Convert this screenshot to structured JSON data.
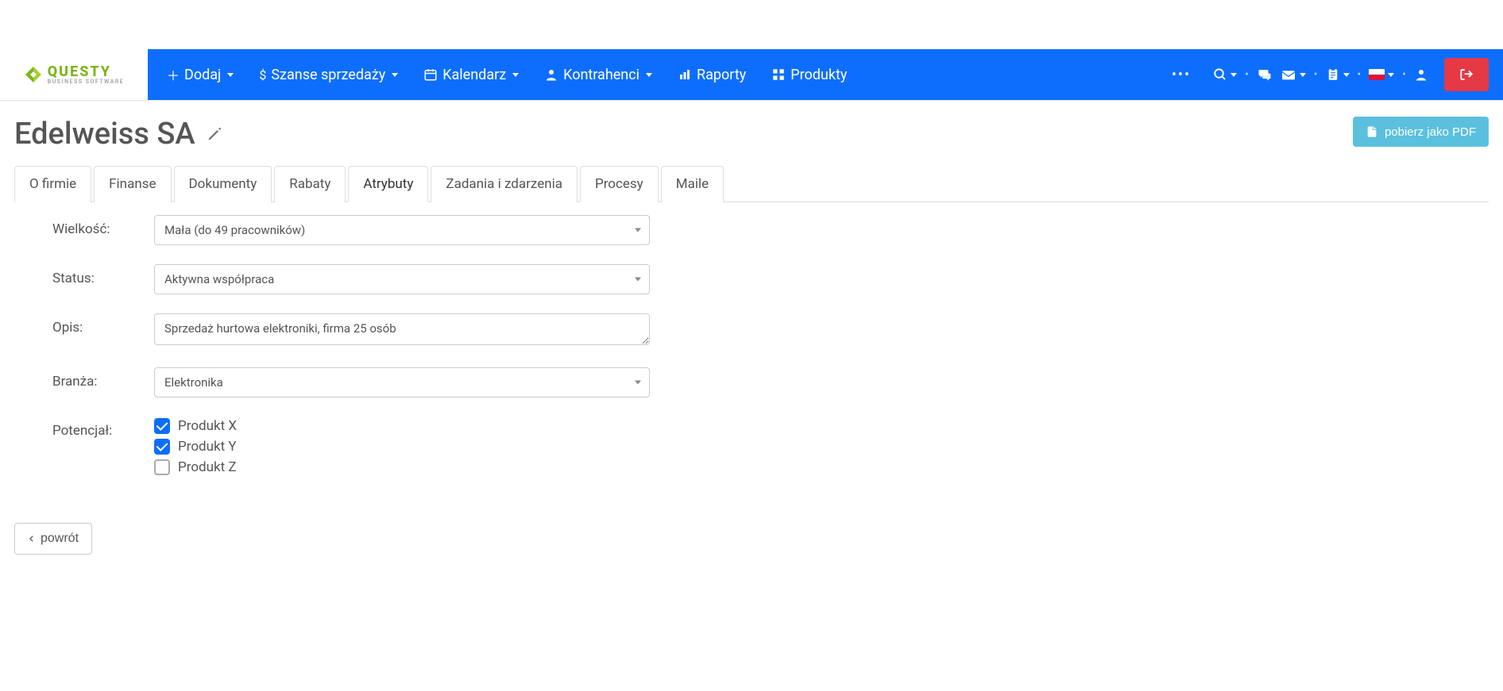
{
  "logo": {
    "brand": "QUESTY",
    "sub": "BUSINESS SOFTWARE"
  },
  "nav": {
    "add": "Dodaj",
    "sales_chances": "Szanse sprzedaży",
    "calendar": "Kalendarz",
    "contractors": "Kontrahenci",
    "reports": "Raporty",
    "products": "Produkty"
  },
  "page": {
    "title": "Edelweiss SA",
    "pdf_button": "pobierz jako PDF",
    "back_button": "powrót"
  },
  "tabs": [
    {
      "id": "about",
      "label": "O firmie"
    },
    {
      "id": "finance",
      "label": "Finanse"
    },
    {
      "id": "documents",
      "label": "Dokumenty"
    },
    {
      "id": "discounts",
      "label": "Rabaty"
    },
    {
      "id": "attributes",
      "label": "Atrybuty",
      "active": true
    },
    {
      "id": "tasks",
      "label": "Zadania i zdarzenia"
    },
    {
      "id": "processes",
      "label": "Procesy"
    },
    {
      "id": "mails",
      "label": "Maile"
    }
  ],
  "form": {
    "size_label": "Wielkość:",
    "size_value": "Mała (do 49 pracowników)",
    "status_label": "Status:",
    "status_value": "Aktywna współpraca",
    "desc_label": "Opis:",
    "desc_value": "Sprzedaż hurtowa elektroniki, firma 25 osób",
    "industry_label": "Branża:",
    "industry_value": "Elektronika",
    "potential_label": "Potencjał:",
    "potential_options": [
      {
        "label": "Produkt X",
        "checked": true
      },
      {
        "label": "Produkt Y",
        "checked": true
      },
      {
        "label": "Produkt Z",
        "checked": false
      }
    ]
  }
}
